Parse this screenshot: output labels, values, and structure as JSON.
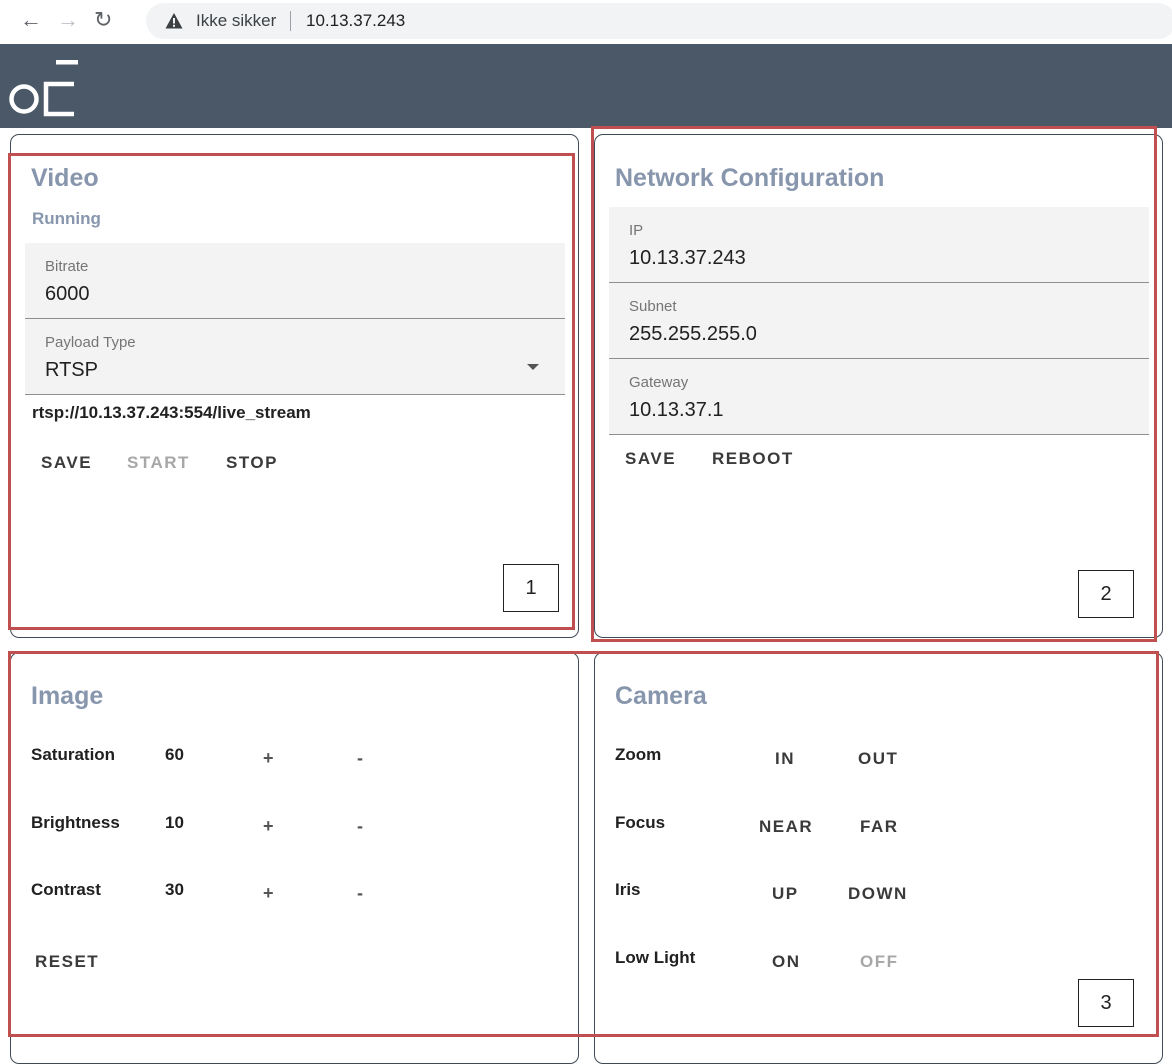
{
  "browser": {
    "security_label": "Ikke sikker",
    "url": "10.13.37.243"
  },
  "video": {
    "title": "Video",
    "status": "Running",
    "bitrate_label": "Bitrate",
    "bitrate_value": "6000",
    "payload_label": "Payload Type",
    "payload_value": "RTSP",
    "stream_url": "rtsp://10.13.37.243:554/live_stream",
    "save_label": "SAVE",
    "start_label": "START",
    "stop_label": "STOP"
  },
  "network": {
    "title": "Network Configuration",
    "ip_label": "IP",
    "ip_value": "10.13.37.243",
    "subnet_label": "Subnet",
    "subnet_value": "255.255.255.0",
    "gateway_label": "Gateway",
    "gateway_value": "10.13.37.1",
    "save_label": "SAVE",
    "reboot_label": "REBOOT"
  },
  "image": {
    "title": "Image",
    "rows": [
      {
        "label": "Saturation",
        "value": "60",
        "plus": "+",
        "minus": "-"
      },
      {
        "label": "Brightness",
        "value": "10",
        "plus": "+",
        "minus": "-"
      },
      {
        "label": "Contrast",
        "value": "30",
        "plus": "+",
        "minus": "-"
      }
    ],
    "reset_label": "RESET"
  },
  "camera": {
    "title": "Camera",
    "rows": [
      {
        "label": "Zoom",
        "a": "IN",
        "b": "OUT"
      },
      {
        "label": "Focus",
        "a": "NEAR",
        "b": "FAR"
      },
      {
        "label": "Iris",
        "a": "UP",
        "b": "DOWN"
      },
      {
        "label": "Low Light",
        "a": "ON",
        "b": "OFF"
      }
    ]
  },
  "annotations": {
    "one": "1",
    "two": "2",
    "three": "3"
  }
}
